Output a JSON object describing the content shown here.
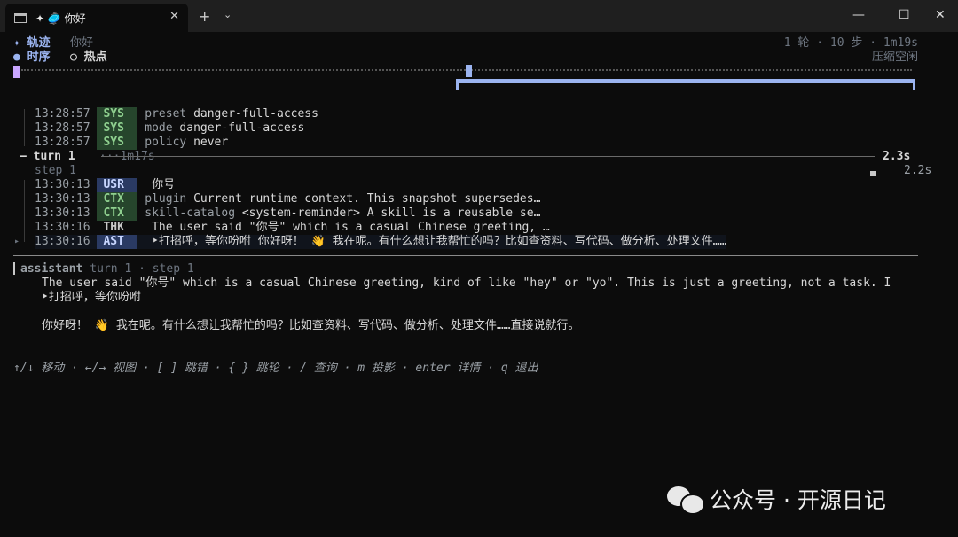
{
  "window": {
    "tab_title": "✦ 🥏 你好",
    "tab_close": "✕",
    "new_tab": "+",
    "tab_menu": "⌄",
    "minimize": "—",
    "maximize": "☐",
    "close": "✕"
  },
  "header": {
    "app_name": "✦ 轨迹",
    "session_title": "你好",
    "stats": "1 轮 · 10 步 · 1m19s",
    "view_timeline": "● 时序",
    "view_hotspot": "○ 热点",
    "compress_label": "压缩空闲"
  },
  "events_pre": [
    {
      "time": "13:28:57",
      "tag": "SYS",
      "key": "preset",
      "value": " danger-full-access"
    },
    {
      "time": "13:28:57",
      "tag": "SYS",
      "key": "mode",
      "value": " danger-full-access"
    },
    {
      "time": "13:28:57",
      "tag": "SYS",
      "key": "policy",
      "value": " never"
    }
  ],
  "turn": {
    "label": "turn 1",
    "gap": "···1m17s",
    "duration": "2.3s",
    "step_label": "step 1",
    "step_duration": "2.2s"
  },
  "events_step": [
    {
      "time": "13:30:13",
      "tag": "USR",
      "key": "",
      "value": " 你号"
    },
    {
      "time": "13:30:13",
      "tag": "CTX",
      "key": "plugin",
      "value": " Current runtime context. This snapshot supersedes…"
    },
    {
      "time": "13:30:13",
      "tag": "CTX",
      "key": "skill-catalog",
      "value": " <system-reminder> A skill is a reusable se…"
    },
    {
      "time": "13:30:16",
      "tag": "THK",
      "key": "",
      "value": " The user said \"你号\" which is a casual Chinese greeting, …"
    },
    {
      "time": "13:30:16",
      "tag": "AST",
      "key": "",
      "value": " ‣打招呼，等你吩咐 你好呀！ 👋 我在呢。有什么想让我帮忙的吗？比如查资料、写代码、做分析、处理文件……"
    }
  ],
  "detail": {
    "role": "assistant",
    "meta": " turn 1 · step 1",
    "thinking": "The user said \"你号\" which is a casual Chinese greeting, kind of like \"hey\" or \"yo\". This is just a greeting, not a task. I",
    "summary": "‣打招呼，等你吩咐",
    "reply": "你好呀！ 👋 我在呢。有什么想让我帮忙的吗？比如查资料、写代码、做分析、处理文件……直接说就行。"
  },
  "footer": {
    "hints": "↑/↓ 移动 · ←/→ 视图 · [ ] 跳错 · { } 跳轮 · / 查询 · m 投影 · enter 详情 · q 退出"
  },
  "watermark": {
    "text": "公众号 · 开源日记"
  }
}
